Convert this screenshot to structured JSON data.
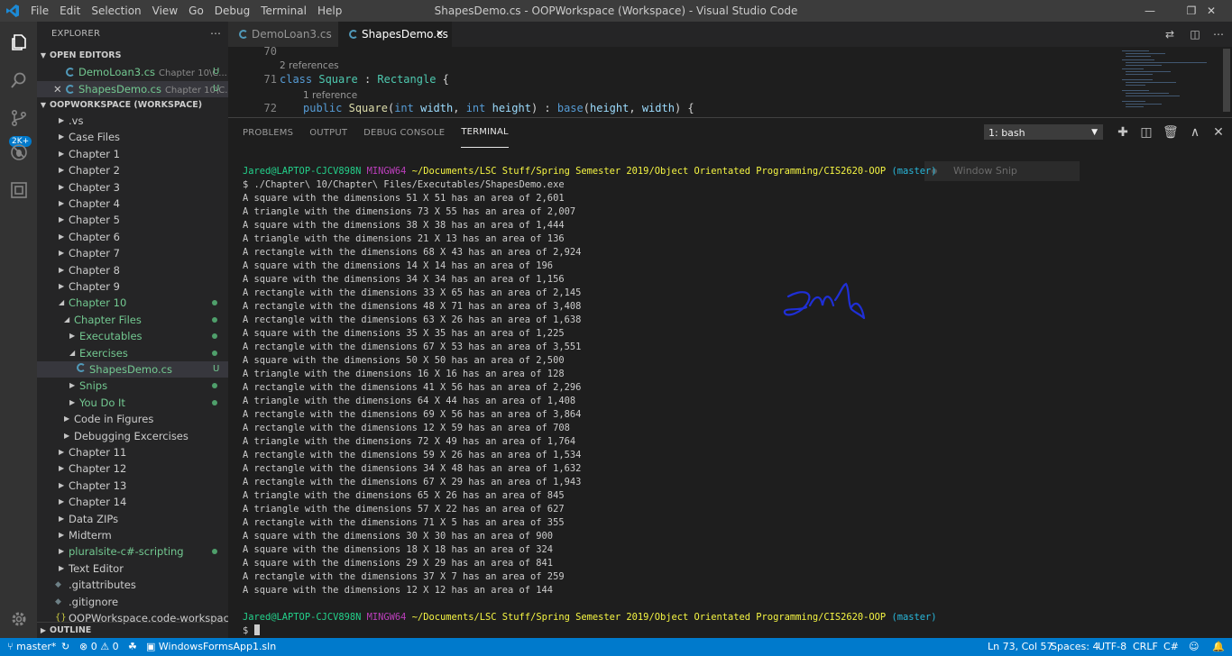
{
  "window": {
    "title": "ShapesDemo.cs - OOPWorkspace (Workspace) - Visual Studio Code",
    "menu": [
      "File",
      "Edit",
      "Selection",
      "View",
      "Go",
      "Debug",
      "Terminal",
      "Help"
    ]
  },
  "activity": {
    "badge": "2K+"
  },
  "sidebar": {
    "title": "EXPLORER",
    "open_editors_title": "OPEN EDITORS",
    "open_editors": [
      {
        "name": "DemoLoan3.cs",
        "desc": "Chapter 10\\C...",
        "status": "U"
      },
      {
        "name": "ShapesDemo.cs",
        "desc": "Chapter 10\\C...",
        "status": "U"
      }
    ],
    "workspace_title": "OOPWORKSPACE (WORKSPACE)",
    "tree": [
      ".vs",
      "Case Files",
      "Chapter 1",
      "Chapter 2",
      "Chapter 3",
      "Chapter 4",
      "Chapter 5",
      "Chapter 6",
      "Chapter 7",
      "Chapter 8",
      "Chapter 9",
      "Chapter 10",
      "Chapter Files",
      "Executables",
      "Exercises",
      "ShapesDemo.cs",
      "Snips",
      "You Do It",
      "Code in Figures",
      "Debugging Excercises",
      "Chapter 11",
      "Chapter 12",
      "Chapter 13",
      "Chapter 14",
      "Data ZIPs",
      "Midterm",
      "pluralsite-c#-scripting",
      "Text Editor",
      ".gitattributes",
      ".gitignore",
      "OOPWorkspace.code-workspace"
    ],
    "shapes_status": "U",
    "outline_title": "OUTLINE"
  },
  "tabs": [
    {
      "label": "DemoLoan3.cs"
    },
    {
      "label": "ShapesDemo.cs"
    }
  ],
  "editor": {
    "line_numbers": [
      "70",
      "71",
      "72"
    ],
    "lens1": "2 references",
    "lens2": "1 reference",
    "line71": {
      "kw": "class",
      "name": "Square",
      "colon": " : ",
      "base": "Rectangle",
      "end": " {"
    },
    "line72": {
      "kw": "public",
      "name": "Square",
      "p1": "(",
      "t1": "int",
      "a1": " width",
      "c1": ", ",
      "t2": "int",
      "a2": " height",
      "p2": ") : ",
      "base": "base",
      "p3": "(",
      "a3": "height",
      "c2": ", ",
      "a4": "width",
      "p4": ") {"
    }
  },
  "panel": {
    "tabs": [
      "PROBLEMS",
      "OUTPUT",
      "DEBUG CONSOLE",
      "TERMINAL"
    ],
    "terminal_select": "1: bash"
  },
  "terminal": {
    "prompt": {
      "user": "Jared@LAPTOP-CJCV898N",
      "ming": "MINGW64",
      "path": "~/Documents/LSC Stuff/Spring Semester 2019/Object Orientated Programming/CIS2620-OOP",
      "branch": "(master)"
    },
    "command": "$ ./Chapter\\ 10/Chapter\\ Files/Executables/ShapesDemo.exe",
    "output": [
      "A square with the dimensions 51 X 51 has an area of 2,601",
      "A triangle with the dimensions 73 X 55 has an area of 2,007",
      "A square with the dimensions 38 X 38 has an area of 1,444",
      "A triangle with the dimensions 21 X 13 has an area of 136",
      "A rectangle with the dimensions 68 X 43 has an area of 2,924",
      "A square with the dimensions 14 X 14 has an area of 196",
      "A square with the dimensions 34 X 34 has an area of 1,156",
      "A rectangle with the dimensions 33 X 65 has an area of 2,145",
      "A rectangle with the dimensions 48 X 71 has an area of 3,408",
      "A rectangle with the dimensions 63 X 26 has an area of 1,638",
      "A square with the dimensions 35 X 35 has an area of 1,225",
      "A rectangle with the dimensions 67 X 53 has an area of 3,551",
      "A square with the dimensions 50 X 50 has an area of 2,500",
      "A triangle with the dimensions 16 X 16 has an area of 128",
      "A rectangle with the dimensions 41 X 56 has an area of 2,296",
      "A triangle with the dimensions 64 X 44 has an area of 1,408",
      "A rectangle with the dimensions 69 X 56 has an area of 3,864",
      "A rectangle with the dimensions 12 X 59 has an area of 708",
      "A triangle with the dimensions 72 X 49 has an area of 1,764",
      "A rectangle with the dimensions 59 X 26 has an area of 1,534",
      "A rectangle with the dimensions 34 X 48 has an area of 1,632",
      "A rectangle with the dimensions 67 X 29 has an area of 1,943",
      "A triangle with the dimensions 65 X 26 has an area of 845",
      "A triangle with the dimensions 57 X 22 has an area of 627",
      "A rectangle with the dimensions 71 X 5 has an area of 355",
      "A square with the dimensions 30 X 30 has an area of 900",
      "A square with the dimensions 18 X 18 has an area of 324",
      "A square with the dimensions 29 X 29 has an area of 841",
      "A rectangle with the dimensions 37 X 7 has an area of 259",
      "A square with the dimensions 12 X 12 has an area of 144"
    ],
    "final_prompt": "$",
    "snip_label": "Window Snip"
  },
  "statusbar": {
    "branch": "master*",
    "errors": "0",
    "warnings": "0",
    "solution": "WindowsFormsApp1.sln",
    "position": "Ln 73, Col 57",
    "spaces": "Spaces: 4",
    "encoding": "UTF-8",
    "eol": "CRLF",
    "language": "C#"
  },
  "colors": {
    "accent": "#007acc",
    "terminal_user": "#23d18b",
    "terminal_path": "#f5f543",
    "terminal_branch": "#29b8db",
    "terminal_ming": "#bc3fbc"
  }
}
